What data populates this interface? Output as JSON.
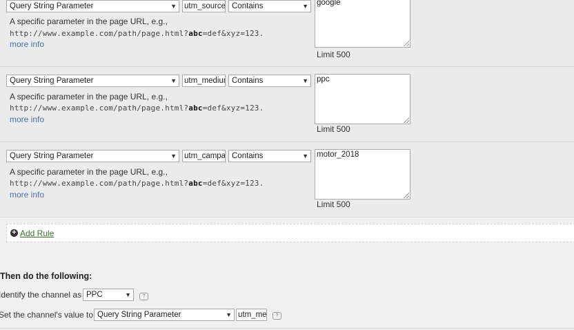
{
  "rules": [
    {
      "type": "Query String Parameter",
      "param": "utm_source",
      "operator": "Contains",
      "value": "google",
      "desc": "A specific parameter in the page URL, e.g.,",
      "url_pre": "http://www.example.com/path/page.html?",
      "url_bold": "abc",
      "url_post": "=def&xyz=123.",
      "more": "more info",
      "limit": "Limit 500"
    },
    {
      "type": "Query String Parameter",
      "param": "utm_medium",
      "operator": "Contains",
      "value": "ppc",
      "desc": "A specific parameter in the page URL, e.g.,",
      "url_pre": "http://www.example.com/path/page.html?",
      "url_bold": "abc",
      "url_post": "=def&xyz=123.",
      "more": "more info",
      "limit": "Limit 500"
    },
    {
      "type": "Query String Parameter",
      "param": "utm_campaign",
      "operator": "Contains",
      "value": "motor_2018",
      "desc": "A specific parameter in the page URL, e.g.,",
      "url_pre": "http://www.example.com/path/page.html?",
      "url_bold": "abc",
      "url_post": "=def&xyz=123.",
      "more": "more info",
      "limit": "Limit 500"
    }
  ],
  "add_rule": "Add Rule",
  "then": {
    "title": "Then do the following:",
    "identify_label": "Identify the channel as",
    "identify_value": "PPC",
    "set_label": "Set the channel's value to",
    "set_type": "Query String Parameter",
    "set_param": "utm_medium"
  },
  "icons": {
    "dropdown": "chevron-down-icon",
    "add": "plus-circle-icon",
    "help": "help-icon"
  },
  "colors": {
    "link": "#4d6fab",
    "add_rule_link": "#3c6e2a",
    "rule_bg": "#ebebeb",
    "page_bg": "#f0f0f0"
  }
}
